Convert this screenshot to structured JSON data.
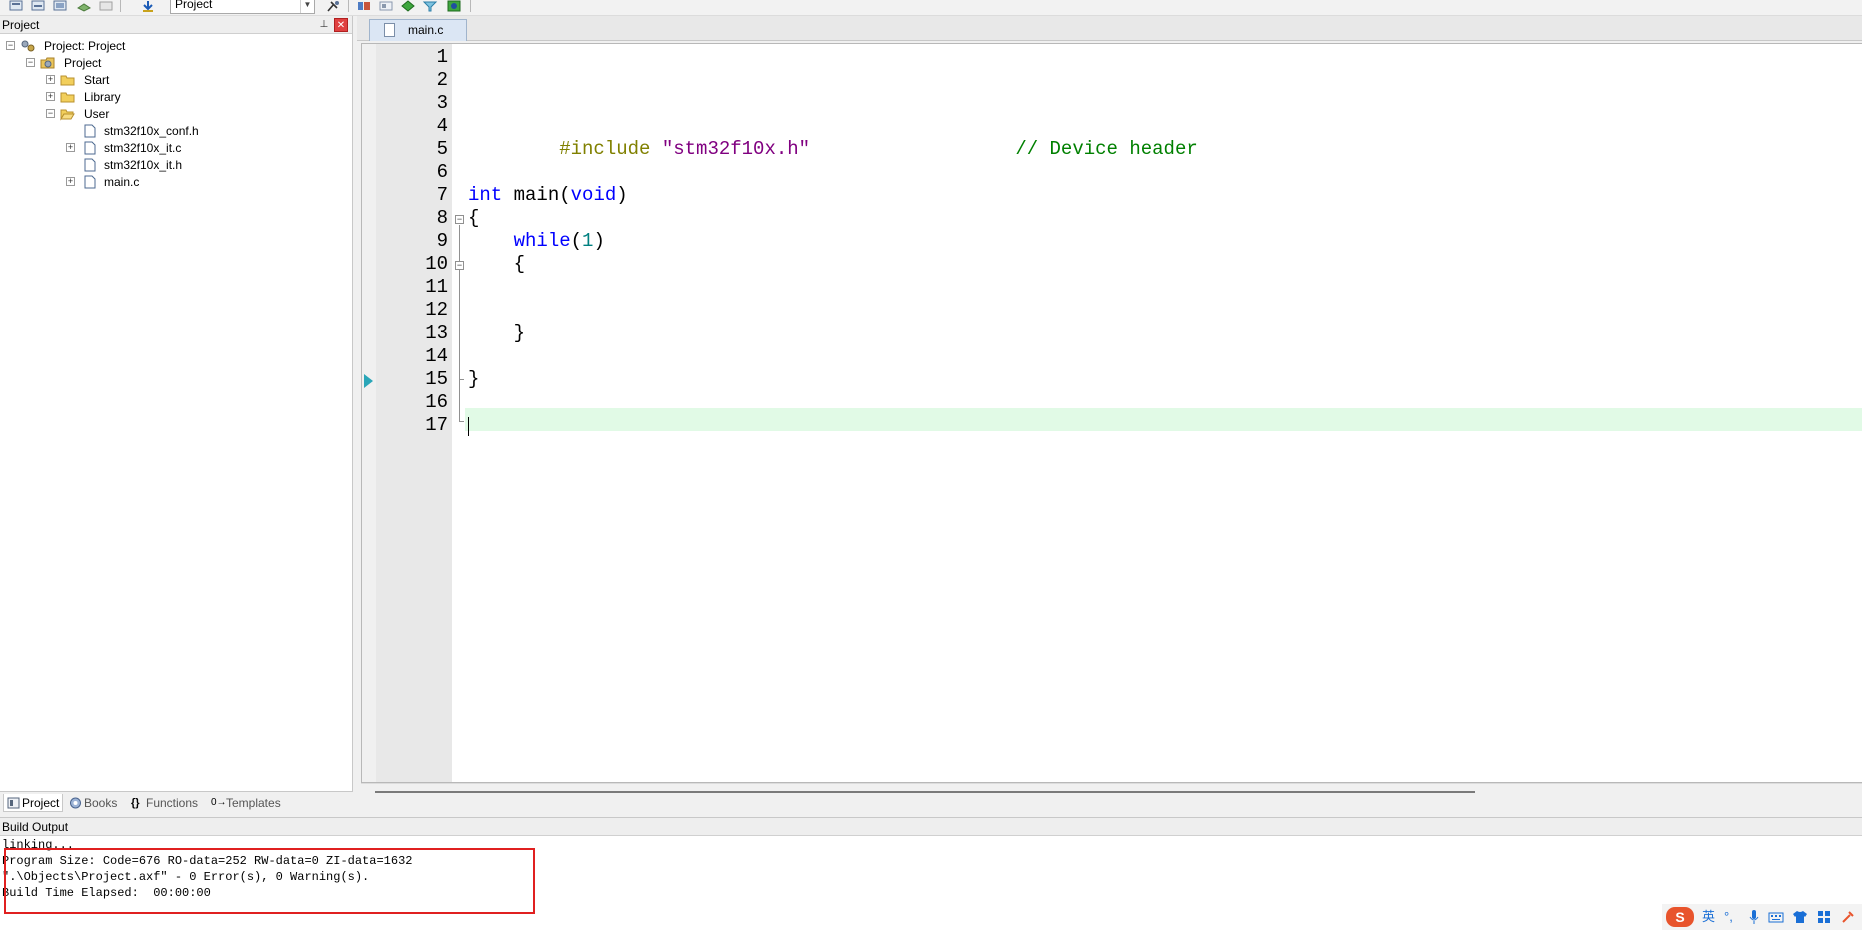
{
  "toolbar": {
    "target_name": "Project"
  },
  "project_pane": {
    "title": "Project",
    "pin_glyph": "▉",
    "close_glyph": "✖",
    "tree": {
      "root": "Project: Project",
      "group": "Project",
      "folders": [
        "Start",
        "Library",
        "User"
      ],
      "user_files": [
        "stm32f10x_conf.h",
        "stm32f10x_it.c",
        "stm32f10x_it.h",
        "main.c"
      ]
    },
    "tabs": [
      {
        "label": "Project",
        "icon": "project-tab-icon",
        "active": true
      },
      {
        "label": "Books",
        "icon": "books-icon",
        "active": false
      },
      {
        "label": "Functions",
        "icon": "functions-icon",
        "glyph": "{}",
        "active": false
      },
      {
        "label": "Templates",
        "icon": "templates-icon",
        "glyph": "0→",
        "active": false
      }
    ]
  },
  "editor": {
    "tab_label": "main.c",
    "line_numbers": [
      "1",
      "2",
      "3",
      "4",
      "5",
      "6",
      "7",
      "8",
      "9",
      "10",
      "11",
      "12",
      "13",
      "14",
      "15",
      "16",
      "17"
    ],
    "code": {
      "line4_directive": "#include",
      "line4_string": "\"stm32f10x.h\"",
      "line4_comment": "// Device header",
      "line7_type": "int",
      "line7_name": " main(",
      "line7_param": "void",
      "line7_close": ")",
      "line8": "{",
      "line9_kw": "while",
      "line9_open": "(",
      "line9_num": "1",
      "line9_close": ")",
      "line10": "{",
      "line13": "}",
      "line16": "}"
    },
    "current_line": 17,
    "colors": {
      "keyword": "#0000ff",
      "preprocessor": "#808000",
      "string": "#800080",
      "number": "#008080",
      "comment": "#008000",
      "current_line_bg": "#e1fae6"
    }
  },
  "build_output": {
    "title": "Build Output",
    "lines": [
      "linking...",
      "Program Size: Code=676 RO-data=252 RW-data=0 ZI-data=1632",
      "\".\\Objects\\Project.axf\" - 0 Error(s), 0 Warning(s).",
      "Build Time Elapsed:  00:00:00"
    ]
  },
  "ime": {
    "logo": "S",
    "mode": "英",
    "punct": "°,",
    "icons": [
      "mic-icon",
      "keyboard-icon",
      "shirt-icon",
      "grid-icon",
      "tools-icon"
    ]
  }
}
